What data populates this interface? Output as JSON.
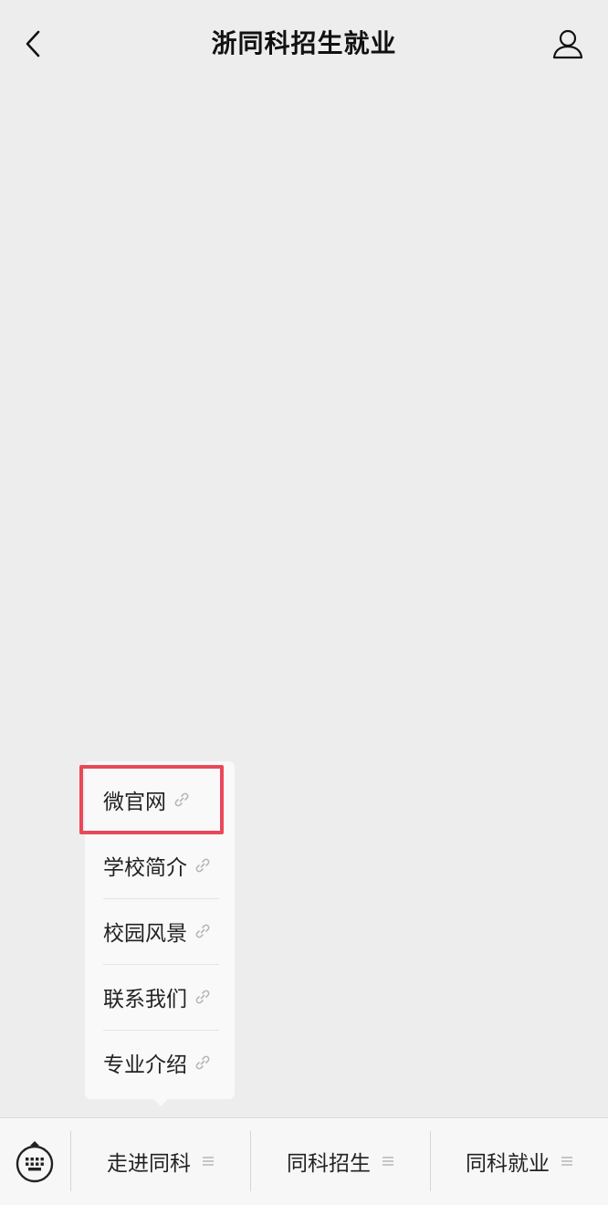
{
  "header": {
    "title": "浙同科招生就业"
  },
  "submenu": {
    "items": [
      {
        "label": "微官网"
      },
      {
        "label": "学校简介"
      },
      {
        "label": "校园风景"
      },
      {
        "label": "联系我们"
      },
      {
        "label": "专业介绍"
      }
    ]
  },
  "bottom_bar": {
    "menus": [
      {
        "label": "走进同科"
      },
      {
        "label": "同科招生"
      },
      {
        "label": "同科就业"
      }
    ]
  },
  "colors": {
    "background": "#ededed",
    "highlight": "#e9485a",
    "bar_background": "#f7f7f7"
  },
  "icons": {
    "back": "chevron-left-icon",
    "profile": "person-icon",
    "link": "link-icon",
    "menu": "hamburger-icon",
    "keyboard": "keyboard-icon"
  }
}
